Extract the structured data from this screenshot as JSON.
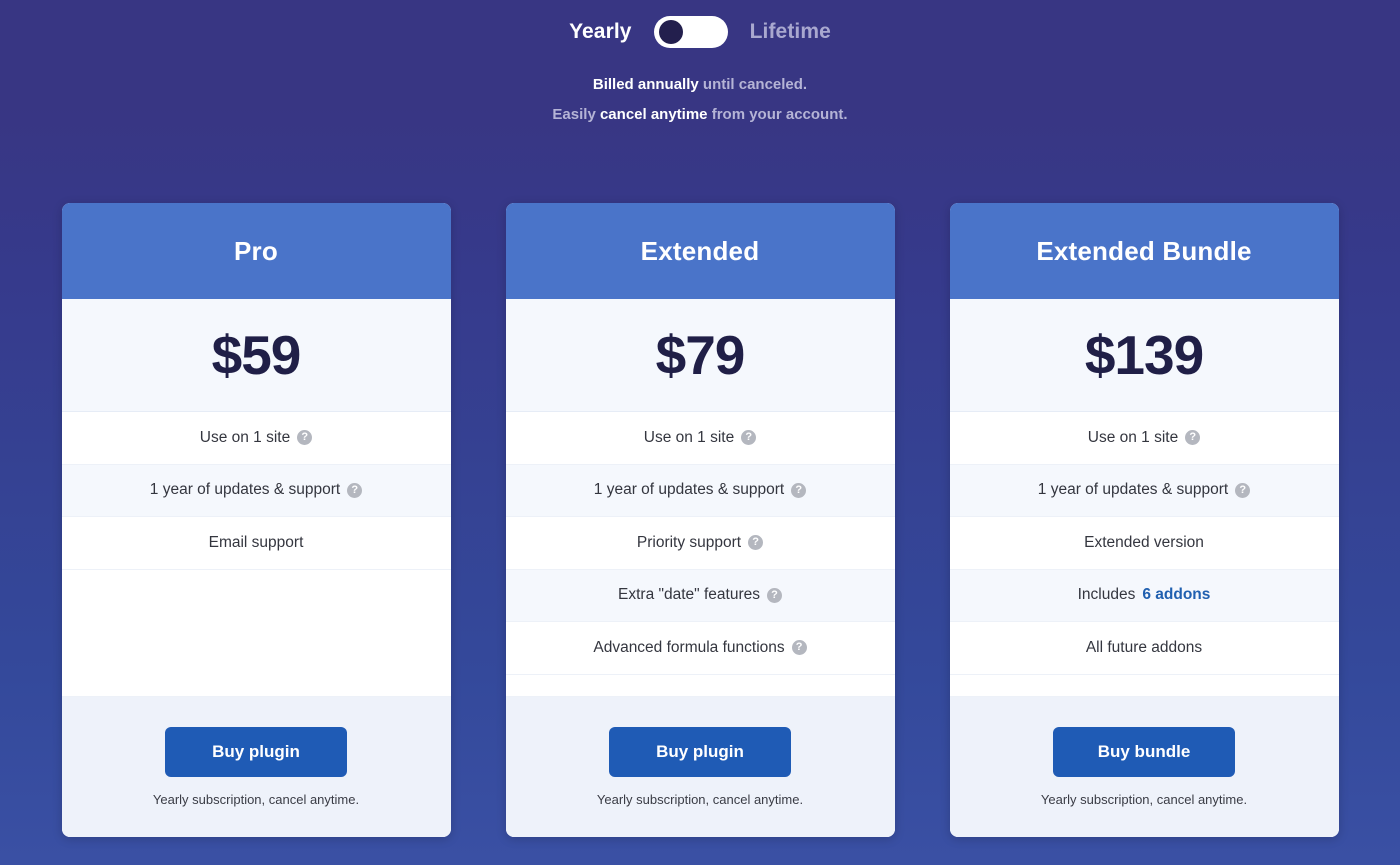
{
  "billing_toggle": {
    "left_label": "Yearly",
    "right_label": "Lifetime",
    "active": "Yearly"
  },
  "billing_note": {
    "line1_bold": "Billed annually",
    "line1_rest": " until canceled.",
    "line2_pre": "Easily ",
    "line2_bold": "cancel anytime",
    "line2_rest": " from your account."
  },
  "help_glyph": "?",
  "plans": [
    {
      "name": "Pro",
      "price": "$59",
      "features": [
        {
          "text": "Use on 1 site",
          "help": true
        },
        {
          "text": "1 year of updates & support",
          "help": true
        },
        {
          "text": "Email support",
          "help": false
        }
      ],
      "button_label": "Buy plugin",
      "footer_note": "Yearly subscription, cancel anytime."
    },
    {
      "name": "Extended",
      "price": "$79",
      "features": [
        {
          "text": "Use on 1 site",
          "help": true
        },
        {
          "text": "1 year of updates & support",
          "help": true
        },
        {
          "text": "Priority support",
          "help": true
        },
        {
          "text": "Extra \"date\" features",
          "help": true
        },
        {
          "text": "Advanced formula functions",
          "help": true
        }
      ],
      "button_label": "Buy plugin",
      "footer_note": "Yearly subscription, cancel anytime."
    },
    {
      "name": "Extended Bundle",
      "price": "$139",
      "features": [
        {
          "text": "Use on 1 site",
          "help": true
        },
        {
          "text": "1 year of updates & support",
          "help": true
        },
        {
          "text": "Extended version",
          "help": false
        },
        {
          "text": "Includes ",
          "link": "6 addons",
          "help": false
        },
        {
          "text": "All future addons",
          "help": false
        }
      ],
      "button_label": "Buy bundle",
      "footer_note": "Yearly subscription, cancel anytime."
    }
  ],
  "colors": {
    "background_top": "#383683",
    "background_bottom": "#3a50a4",
    "card_header": "#4a74c9",
    "button": "#1f5bb5",
    "price_text": "#201f47",
    "link": "#2060b0"
  }
}
